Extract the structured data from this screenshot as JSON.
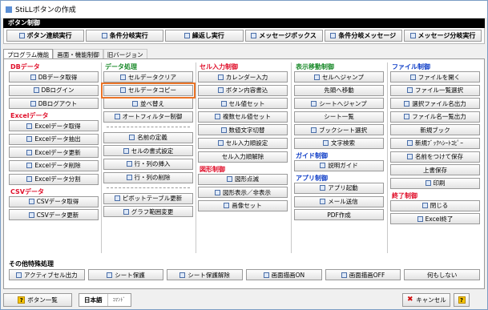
{
  "window": {
    "title": "StiLLボタンの作成"
  },
  "button_control": {
    "header": "ボタン制御",
    "buttons": [
      "ボタン連続実行",
      "条件分岐実行",
      "繰返し実行",
      "メッセージボックス",
      "条件分岐メッセージ",
      "メッセージ分岐実行"
    ]
  },
  "tabs": [
    "プログラム機能",
    "画面・機能制御",
    "旧バージョン"
  ],
  "columns": [
    {
      "sections": [
        {
          "title": "DBデータ",
          "color": "red",
          "buttons": [
            "DBデータ取得",
            "DBログイン",
            "DBログアウト"
          ]
        },
        {
          "title": "Excelデータ",
          "color": "red",
          "buttons": [
            "Excelデータ取得",
            "Excelデータ抽出",
            "Excelデータ更新",
            "Excelデータ削除",
            "Excelデータ分割"
          ]
        },
        {
          "title": "CSVデータ",
          "color": "red",
          "buttons": [
            "CSVデータ取得",
            "CSVデータ更新"
          ]
        }
      ]
    },
    {
      "sections": [
        {
          "title": "データ処理",
          "color": "green",
          "buttons": [
            "セルデータクリア",
            "セルデータコピー",
            "並べ替え",
            "オートフィルター制御"
          ]
        },
        {
          "title": "",
          "color": "green",
          "buttons": [
            "名前の定義",
            "セルの書式設定",
            "行・列の挿入",
            "行・列の削除"
          ]
        },
        {
          "title": "",
          "color": "green",
          "buttons": [
            "ピボットテーブル更新",
            "グラフ範囲変更"
          ]
        }
      ]
    },
    {
      "sections": [
        {
          "title": "セル入力制御",
          "color": "red",
          "buttons": [
            "カレンダー入力",
            "ボタン内容書込",
            "セル値セット",
            "複数セル値セット",
            "数値文字切替",
            "セル入力順設定",
            "セル入力順解除"
          ]
        },
        {
          "title": "図形制御",
          "color": "red",
          "buttons": [
            "図形点滅",
            "図形表示／非表示",
            "画像セット"
          ]
        }
      ]
    },
    {
      "sections": [
        {
          "title": "表示移動制御",
          "color": "green",
          "buttons": [
            "セルへジャンプ",
            "先頭へ移動",
            "シートへジャンプ",
            "シート一覧",
            "ブックシート選択",
            "文字検索"
          ]
        },
        {
          "title": "ガイド制御",
          "color": "blue",
          "buttons": [
            "説明ガイド"
          ]
        },
        {
          "title": "アプリ制御",
          "color": "blue",
          "buttons": [
            "アプリ起動",
            "メール送信",
            "PDF作成"
          ]
        }
      ]
    },
    {
      "sections": [
        {
          "title": "ファイル制御",
          "color": "blue",
          "buttons": [
            "ファイルを開く",
            "ファイル一覧選択",
            "選択ファイル名出力",
            "ファイル名一覧出力",
            "新規ブック",
            "新規ﾌﾞｯｸﾍｼｰﾄｺﾋﾟｰ",
            "名前をつけて保存",
            "上書保存",
            "印刷"
          ]
        },
        {
          "title": "終了制御",
          "color": "red",
          "buttons": [
            "閉じる",
            "Excel終了"
          ]
        }
      ]
    }
  ],
  "other": {
    "title": "その他特殊処理",
    "buttons": [
      "アクティブセル出力",
      "シート保護",
      "シート保護解除",
      "画面描画ON",
      "画面描画OFF",
      "何もしない"
    ]
  },
  "footer": {
    "button_list_label": "ボタン一覧",
    "lang_active": "日本語",
    "lang_inactive": "ｺﾏﾝﾄﾞ",
    "cancel_label": "キャンセル",
    "help_glyph": "?"
  },
  "highlighted_button": "セルデータコピー",
  "colors": {
    "red": "#e0102b",
    "green": "#1a8a2a",
    "blue": "#1240c8",
    "highlight": "#ea7427"
  }
}
